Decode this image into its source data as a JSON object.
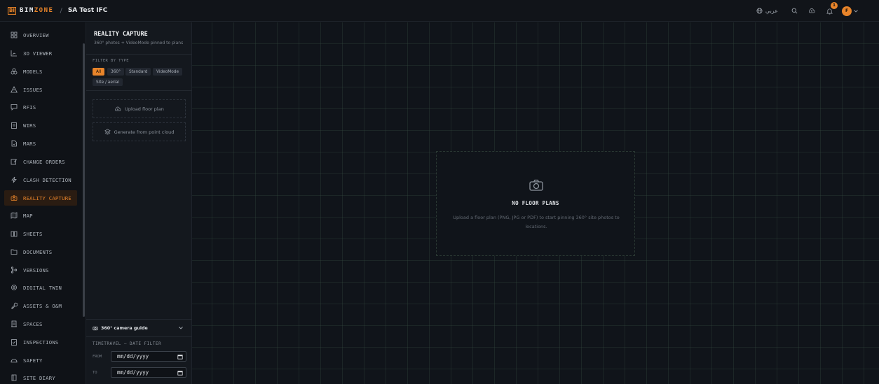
{
  "topbar": {
    "logo_mark": "BI",
    "logo_text_a": "BIM",
    "logo_text_b": "ZONE",
    "separator": "/",
    "project": "SA Test IFC",
    "language": "عربي",
    "notification_count": "1",
    "avatar_initial": "F"
  },
  "nav": {
    "items": [
      {
        "label": "OVERVIEW",
        "icon": "grid-icon"
      },
      {
        "label": "3D VIEWER",
        "icon": "chart-icon"
      },
      {
        "label": "MODELS",
        "icon": "cubes-icon"
      },
      {
        "label": "ISSUES",
        "icon": "warning-icon"
      },
      {
        "label": "RFIS",
        "icon": "chat-icon"
      },
      {
        "label": "WIRS",
        "icon": "clipboard-icon"
      },
      {
        "label": "MARS",
        "icon": "file-icon"
      },
      {
        "label": "CHANGE ORDERS",
        "icon": "edit-icon"
      },
      {
        "label": "CLASH DETECTION",
        "icon": "bolt-icon"
      },
      {
        "label": "REALITY CAPTURE",
        "icon": "camera-icon"
      },
      {
        "label": "MAP",
        "icon": "map-icon"
      },
      {
        "label": "SHEETS",
        "icon": "book-icon"
      },
      {
        "label": "DOCUMENTS",
        "icon": "folder-icon"
      },
      {
        "label": "VERSIONS",
        "icon": "branch-icon"
      },
      {
        "label": "DIGITAL TWIN",
        "icon": "target-icon"
      },
      {
        "label": "ASSETS & O&M",
        "icon": "wrench-icon"
      },
      {
        "label": "SPACES",
        "icon": "building-icon"
      },
      {
        "label": "INSPECTIONS",
        "icon": "checklist-icon"
      },
      {
        "label": "SAFETY",
        "icon": "helmet-icon"
      },
      {
        "label": "SITE DIARY",
        "icon": "diary-icon"
      }
    ],
    "active": "REALITY CAPTURE"
  },
  "panel": {
    "title": "REALITY CAPTURE",
    "subtitle": "360° photos + VideoMode pinned to plans",
    "filter_label": "FILTER BY TYPE",
    "filters": [
      "All",
      "360°",
      "Standard",
      "VideoMode",
      "Site / aerial"
    ],
    "active_filter": "All",
    "upload_label": "Upload floor plan",
    "generate_label": "Generate from point cloud",
    "guide_label": "360° camera guide",
    "timetravel_label": "TIMETRAVEL — DATE FILTER",
    "from_label": "FROM",
    "to_label": "TO",
    "from_value": "mm/dd/yyyy",
    "to_value": "mm/dd/yyyy"
  },
  "empty_state": {
    "title": "NO FLOOR PLANS",
    "description": "Upload a floor plan (PNG, JPG or PDF) to start pinning 360° site photos to locations."
  },
  "colors": {
    "accent": "#e8842a",
    "background": "#0f1217",
    "panel": "#14181e"
  }
}
